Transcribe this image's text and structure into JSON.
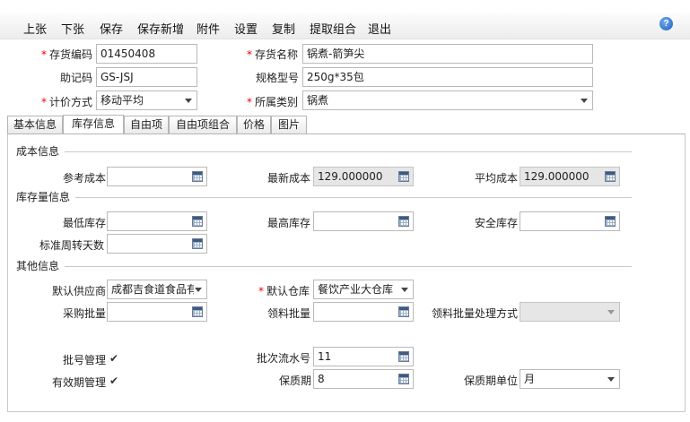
{
  "toolbar": {
    "items": [
      "上张",
      "下张",
      "保存",
      "保存新增",
      "附件",
      "设置",
      "复制",
      "提取组合",
      "退出"
    ]
  },
  "header": {
    "code_label": "存货编码",
    "code_value": "01450408",
    "name_label": "存货名称",
    "name_value": "锅煮-箭笋尖",
    "mnemonic_label": "助记码",
    "mnemonic_value": "GS-JSJ",
    "spec_label": "规格型号",
    "spec_value": "250g*35包",
    "pricing_label": "计价方式",
    "pricing_value": "移动平均",
    "category_label": "所属类别",
    "category_value": "锅煮"
  },
  "tabs": [
    "基本信息",
    "库存信息",
    "自由项",
    "自由项组合",
    "价格",
    "图片"
  ],
  "active_tab": "库存信息",
  "sections": {
    "cost": {
      "title": "成本信息",
      "ref_cost_label": "参考成本",
      "ref_cost_value": "",
      "latest_cost_label": "最新成本",
      "latest_cost_value": "129.000000",
      "avg_cost_label": "平均成本",
      "avg_cost_value": "129.000000"
    },
    "stock": {
      "title": "库存量信息",
      "min_label": "最低库存",
      "min_value": "",
      "max_label": "最高库存",
      "max_value": "",
      "safety_label": "安全库存",
      "safety_value": "",
      "turnover_label": "标准周转天数",
      "turnover_value": ""
    },
    "other": {
      "title": "其他信息",
      "supplier_label": "默认供应商",
      "supplier_value": "成都吉食道食品有",
      "warehouse_label": "默认仓库",
      "warehouse_value": "餐饮产业大仓库",
      "purchase_batch_label": "采购批量",
      "purchase_batch_value": "",
      "requisition_batch_label": "领料批量",
      "requisition_batch_value": "",
      "batch_method_label": "领料批量处理方式",
      "batch_method_value": "",
      "lot_mgmt_label": "批号管理",
      "lot_mgmt_checked": true,
      "serial_label": "批次流水号",
      "serial_value": "11",
      "expiry_mgmt_label": "有效期管理",
      "expiry_mgmt_checked": true,
      "shelf_life_label": "保质期",
      "shelf_life_value": "8",
      "shelf_unit_label": "保质期单位",
      "shelf_unit_value": "月"
    }
  },
  "colors": {
    "required": "#ee0000",
    "disabled_bg": "#e6e6e6",
    "accent": "#1d5fbf"
  }
}
